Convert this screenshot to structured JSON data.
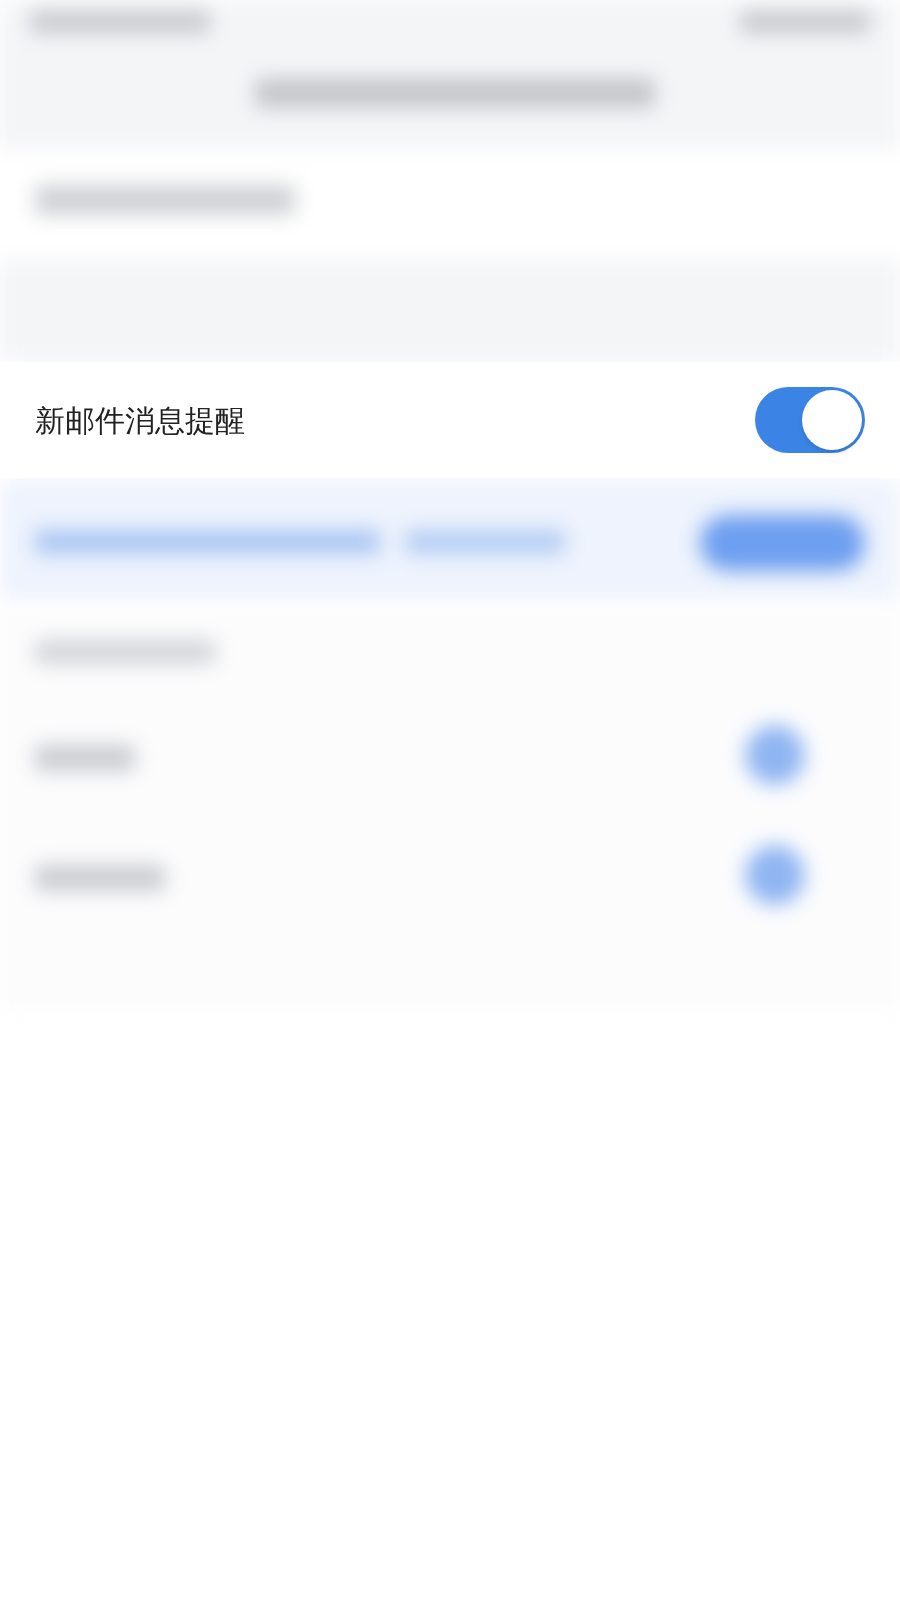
{
  "setting": {
    "label": "新邮件消息提醒",
    "on": true
  }
}
